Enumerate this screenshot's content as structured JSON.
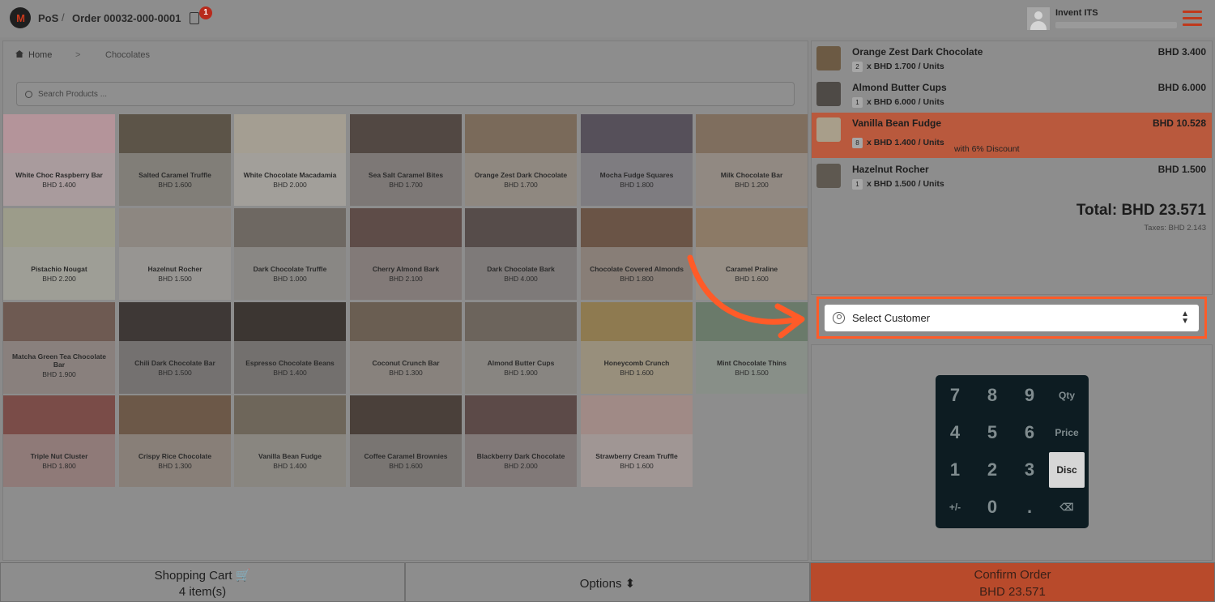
{
  "header": {
    "logo_text": "M",
    "app": "PoS",
    "separator": "/",
    "order": "Order 00032-000-0001",
    "order_badge": "1",
    "user": "Invent ITS"
  },
  "catalog": {
    "breadcrumb": {
      "home": "Home",
      "sep": ">",
      "category": "Chocolates"
    },
    "search_placeholder": "Search Products ...",
    "products": [
      {
        "name": "White Choc Raspberry Bar",
        "price": "BHD 1.400",
        "bg": "#b4949a"
      },
      {
        "name": "Salted Caramel Truffle",
        "price": "BHD 1.600",
        "bg": "#5c5448"
      },
      {
        "name": "White Chocolate Macadamia",
        "price": "BHD 2.000",
        "bg": "#a49e92"
      },
      {
        "name": "Sea Salt Caramel Bites",
        "price": "BHD 1.700",
        "bg": "#524843"
      },
      {
        "name": "Orange Zest Dark Chocolate",
        "price": "BHD 1.700",
        "bg": "#7a6a5a"
      },
      {
        "name": "Mocha Fudge Squares",
        "price": "BHD 1.800",
        "bg": "#56505a"
      },
      {
        "name": "Milk Chocolate Bar",
        "price": "BHD 1.200",
        "bg": "#7f6e5e"
      },
      {
        "name": "Pistachio Nougat",
        "price": "BHD 2.200",
        "bg": "#9c9c8a"
      },
      {
        "name": "Hazelnut Rocher",
        "price": "BHD 1.500",
        "bg": "#8d8781"
      },
      {
        "name": "Dark Chocolate Truffle",
        "price": "BHD 1.000",
        "bg": "#6e6862"
      },
      {
        "name": "Cherry Almond Bark",
        "price": "BHD 2.100",
        "bg": "#5e4c48"
      },
      {
        "name": "Dark Chocolate Bark",
        "price": "BHD 4.000",
        "bg": "#564c4a"
      },
      {
        "name": "Chocolate Covered Almonds",
        "price": "BHD 1.800",
        "bg": "#6a5446"
      },
      {
        "name": "Caramel Praline",
        "price": "BHD 1.600",
        "bg": "#8c7a66"
      },
      {
        "name": "Matcha Green Tea Chocolate Bar",
        "price": "BHD 1.900",
        "bg": "#6e5a52"
      },
      {
        "name": "Chili Dark Chocolate Bar",
        "price": "BHD 1.500",
        "bg": "#3e3836"
      },
      {
        "name": "Espresso Chocolate Beans",
        "price": "BHD 1.400",
        "bg": "#3c3632"
      },
      {
        "name": "Coconut Crunch Bar",
        "price": "BHD 1.300",
        "bg": "#6a5e52"
      },
      {
        "name": "Almond Butter Cups",
        "price": "BHD 1.900",
        "bg": "#6c645c"
      },
      {
        "name": "Honeycomb Crunch",
        "price": "BHD 1.600",
        "bg": "#8e7a50"
      },
      {
        "name": "Mint Chocolate Thins",
        "price": "BHD 1.500",
        "bg": "#6a7a6a"
      },
      {
        "name": "Triple Nut Cluster",
        "price": "BHD 1.800",
        "bg": "#7a4c48"
      },
      {
        "name": "Crispy Rice Chocolate",
        "price": "BHD 1.300",
        "bg": "#6c5848"
      },
      {
        "name": "Vanilla Bean Fudge",
        "price": "BHD 1.400",
        "bg": "#6e665a"
      },
      {
        "name": "Coffee Caramel Brownies",
        "price": "BHD 1.600",
        "bg": "#4a403a"
      },
      {
        "name": "Blackberry Dark Chocolate",
        "price": "BHD 2.000",
        "bg": "#5c4a48"
      },
      {
        "name": "Strawberry Cream Truffle",
        "price": "BHD 1.600",
        "bg": "#a08a86"
      }
    ]
  },
  "order_lines": [
    {
      "name": "Orange Zest Dark Chocolate",
      "total": "BHD 3.400",
      "qty": "2",
      "unit": "x BHD 1.700 / Units",
      "discount": "",
      "thumb": "#6c5a44",
      "selected": false
    },
    {
      "name": "Almond Butter Cups",
      "total": "BHD 6.000",
      "qty": "1",
      "unit": "x BHD 6.000 / Units",
      "discount": "",
      "thumb": "#4e4a46",
      "selected": false
    },
    {
      "name": "Vanilla Bean Fudge",
      "total": "BHD 10.528",
      "qty": "8",
      "unit": "x BHD 1.400 / Units",
      "discount": "with 6% Discount",
      "thumb": "#a89e8a",
      "selected": true
    },
    {
      "name": "Hazelnut Rocher",
      "total": "BHD 1.500",
      "qty": "1",
      "unit": "x BHD 1.500 / Units",
      "discount": "",
      "thumb": "#5e5850",
      "selected": false
    }
  ],
  "summary": {
    "total": "Total: BHD 23.571",
    "taxes": "Taxes: BHD 2.143"
  },
  "customer": {
    "placeholder": "Select Customer",
    "icon": "user-circle-icon"
  },
  "numpad": {
    "keys": [
      [
        "7",
        "8",
        "9",
        "Qty"
      ],
      [
        "4",
        "5",
        "6",
        "Price"
      ],
      [
        "1",
        "2",
        "3",
        "Disc"
      ],
      [
        "+/-",
        "0",
        ".",
        "⌫"
      ]
    ],
    "active": "Disc"
  },
  "footer": {
    "cart_label": "Shopping Cart 🛒",
    "cart_count": "4 item(s)",
    "options_label": "Options ⬍",
    "confirm_label": "Confirm Order",
    "confirm_total": "BHD 23.571"
  },
  "colors": {
    "accent": "#ff5b28",
    "brand": "#c0391c"
  }
}
